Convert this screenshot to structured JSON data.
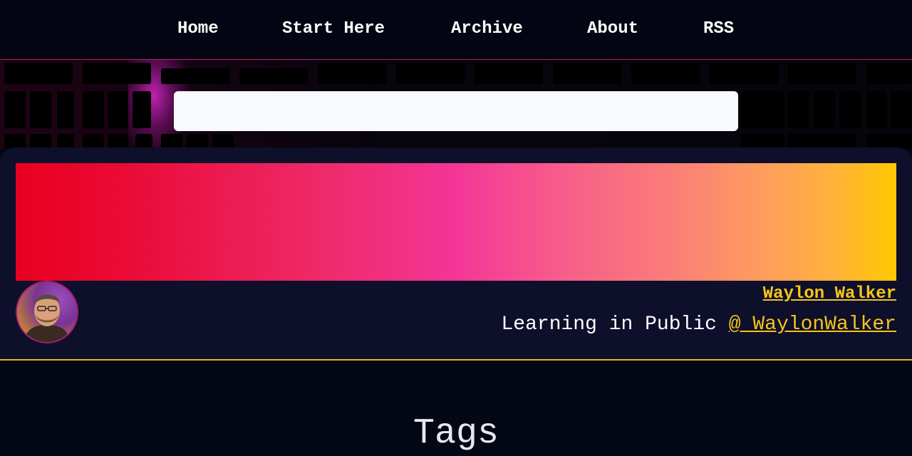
{
  "nav": {
    "items": [
      {
        "label": "Home"
      },
      {
        "label": "Start Here"
      },
      {
        "label": "Archive"
      },
      {
        "label": "About"
      },
      {
        "label": "RSS"
      }
    ]
  },
  "search": {
    "value": "",
    "placeholder": ""
  },
  "profile": {
    "name": "Waylon Walker",
    "tagline": "Learning in Public",
    "handle": "@ WaylonWalker"
  },
  "page": {
    "title": "Tags"
  },
  "colors": {
    "background": "#040714",
    "card": "#0d0f2b",
    "accent_yellow": "#f5c518",
    "accent_pink": "#f43597",
    "accent_red": "#e8001f"
  }
}
